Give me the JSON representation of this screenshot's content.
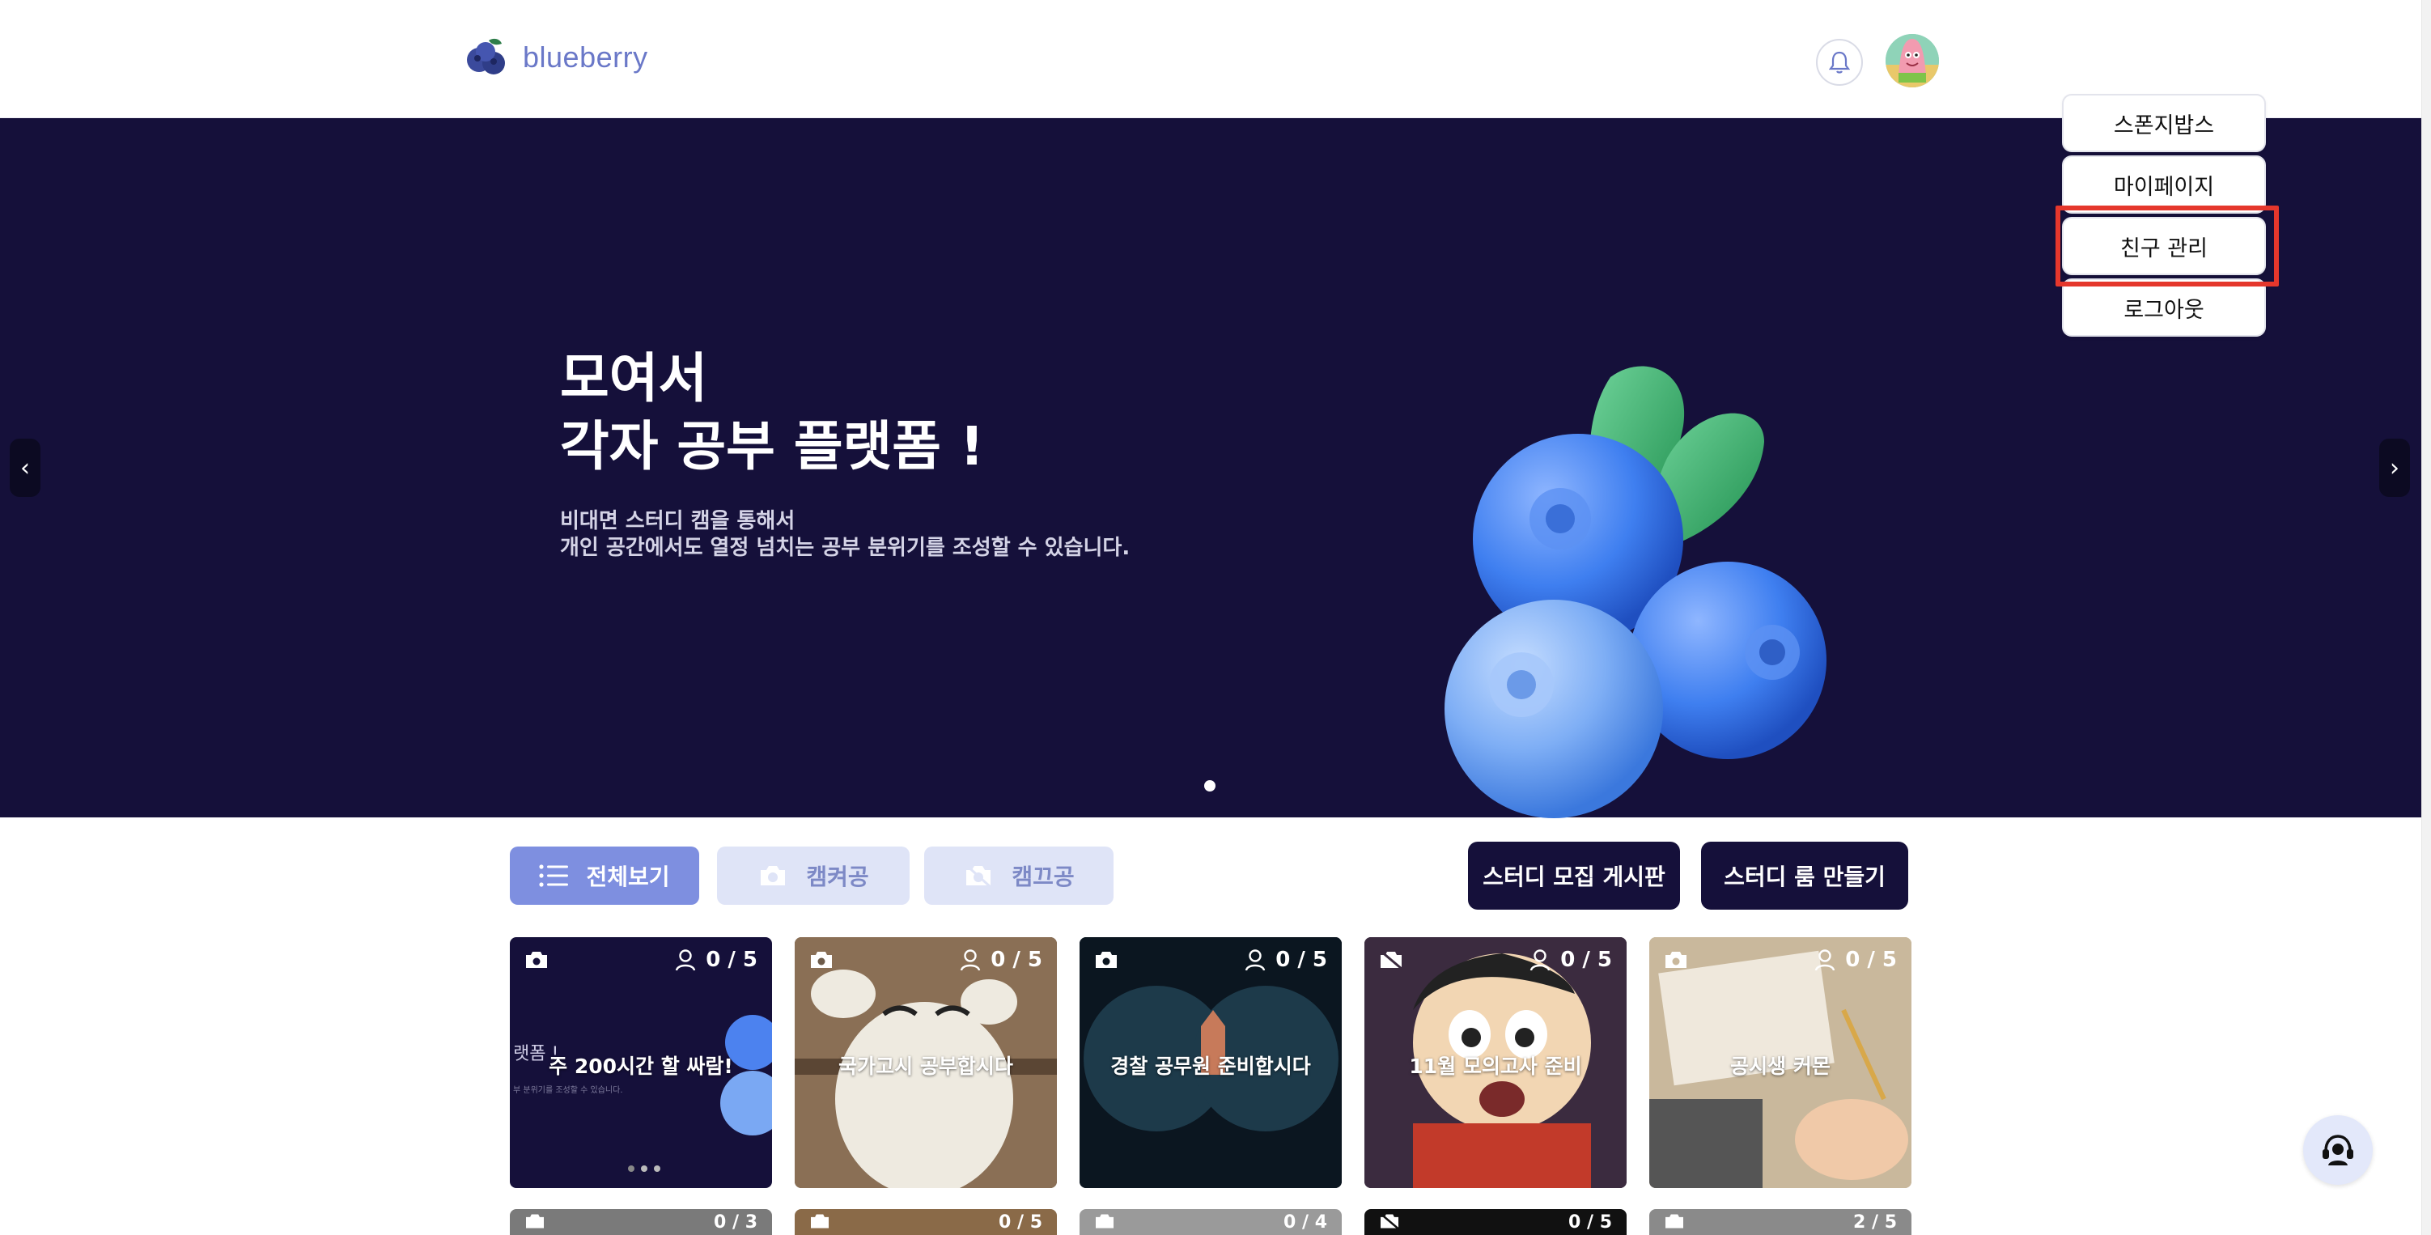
{
  "header": {
    "brand_name": "blueberry",
    "bell_icon": "bell-icon",
    "avatar_icon": "avatar-patrick"
  },
  "user_menu": {
    "items": [
      {
        "label": "스폰지밥스"
      },
      {
        "label": "마이페이지"
      },
      {
        "label": "친구 관리"
      },
      {
        "label": "로그아웃"
      }
    ],
    "highlight_color": "#e5372c"
  },
  "hero": {
    "title_line1": "모여서",
    "title_line2": "각자 공부 플랫폼 !",
    "sub_line1": "비대면 스터디 캠을 통해서",
    "sub_line2": "개인 공간에서도 열정 넘치는 공부 분위기를 조성할 수 있습니다.",
    "prev": "‹",
    "next": "›",
    "background": "#15103a"
  },
  "filters": {
    "all": "전체보기",
    "cam_on": "캠켜공",
    "cam_off": "캠끄공"
  },
  "actions": {
    "recruit_board": "스터디 모집 게시판",
    "create_room": "스터디 룸 만들기"
  },
  "rooms": [
    {
      "title": "주 200시간 할 싸람!",
      "count": "0 / 5",
      "camera": "on"
    },
    {
      "title": "국가고시 공부합시다",
      "count": "0 / 5",
      "camera": "on"
    },
    {
      "title": "경찰 공무원 준비합시다",
      "count": "0 / 5",
      "camera": "on"
    },
    {
      "title": "11월 모의고사 준비",
      "count": "0 / 5",
      "camera": "off"
    },
    {
      "title": "공시생 커몬",
      "count": "0 / 5",
      "camera": "on"
    }
  ],
  "rooms_row2": [
    {
      "count": "0 / 3"
    },
    {
      "count": "0 / 5"
    },
    {
      "count": "0 / 4"
    },
    {
      "count": "0 / 5"
    },
    {
      "count": "2 / 5"
    }
  ],
  "card1_overlay": {
    "left_text": "랫폼 !",
    "small_text": "부 분위기를 조성할 수 있습니다."
  },
  "help_icon": "headset-icon"
}
